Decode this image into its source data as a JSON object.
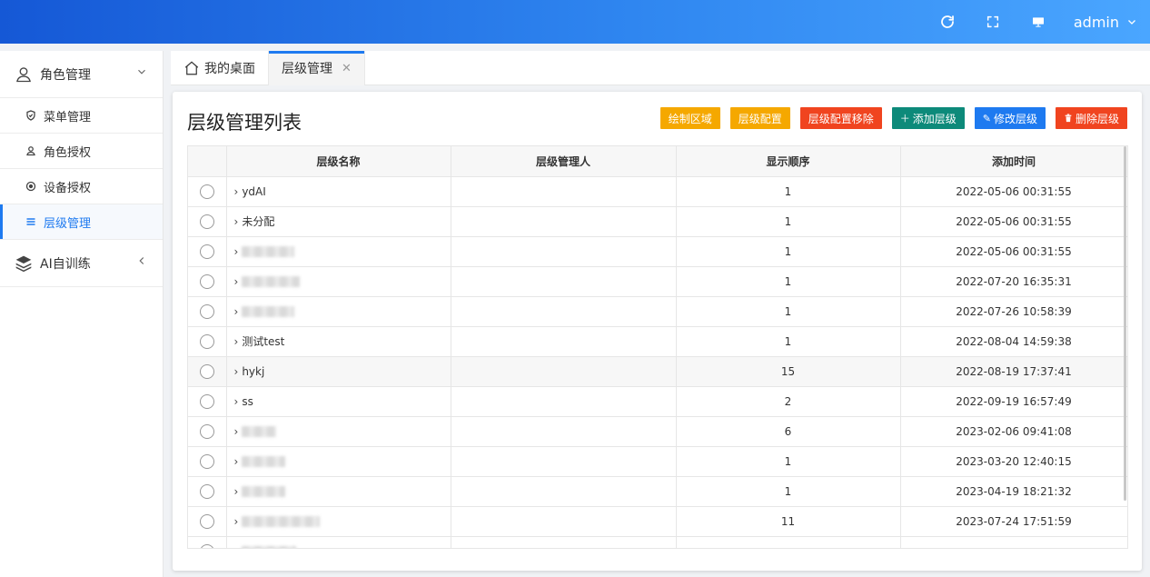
{
  "header": {
    "user": "admin",
    "tools": [
      "refresh-icon",
      "fullscreen-icon",
      "monitor-icon"
    ]
  },
  "sidebar": {
    "groups": [
      {
        "label": "角色管理",
        "icon": "user-icon",
        "expanded": true,
        "items": [
          {
            "label": "菜单管理",
            "icon": "shield-icon"
          },
          {
            "label": "角色授权",
            "icon": "user-small-icon"
          },
          {
            "label": "设备授权",
            "icon": "target-icon"
          },
          {
            "label": "层级管理",
            "icon": "list-icon",
            "active": true
          }
        ]
      },
      {
        "label": "AI自训练",
        "icon": "layers-icon",
        "expanded": false
      }
    ]
  },
  "tabs": [
    {
      "label": "我的桌面",
      "icon": "home-icon"
    },
    {
      "label": "层级管理",
      "active": true,
      "closable": true
    }
  ],
  "panel": {
    "title": "层级管理列表",
    "buttons": [
      {
        "label": "绘制区域",
        "color": "#f5a800"
      },
      {
        "label": "层级配置",
        "color": "#f5a800"
      },
      {
        "label": "层级配置移除",
        "color": "#f0441f"
      },
      {
        "label": "添加层级",
        "color": "#0d8a7a",
        "icon": "+"
      },
      {
        "label": "修改层级",
        "color": "#1e7af0",
        "icon": "✎"
      },
      {
        "label": "删除层级",
        "color": "#f0441f",
        "icon": "🗑"
      }
    ]
  },
  "table": {
    "columns": [
      "",
      "层级名称",
      "层级管理人",
      "显示顺序",
      "添加时间"
    ],
    "rows": [
      {
        "name": "ydAI",
        "manager": "",
        "order": "1",
        "time": "2022-05-06 00:31:55"
      },
      {
        "name": "未分配",
        "manager": "",
        "order": "1",
        "time": "2022-05-06 00:31:55"
      },
      {
        "name": "",
        "manager": "",
        "order": "1",
        "time": "2022-05-06 00:31:55",
        "blur": 58
      },
      {
        "name": "",
        "manager": "",
        "order": "1",
        "time": "2022-07-20 16:35:31",
        "blur": 64
      },
      {
        "name": "",
        "manager": "",
        "order": "1",
        "time": "2022-07-26 10:58:39",
        "blur": 58
      },
      {
        "name": "测试test",
        "manager": "",
        "order": "1",
        "time": "2022-08-04 14:59:38"
      },
      {
        "name": "hykj",
        "manager": "",
        "order": "15",
        "time": "2022-08-19 17:37:41",
        "highlight": true
      },
      {
        "name": "ss",
        "manager": "",
        "order": "2",
        "time": "2022-09-19 16:57:49"
      },
      {
        "name": "",
        "manager": "",
        "order": "6",
        "time": "2023-02-06 09:41:08",
        "blur": 38
      },
      {
        "name": "",
        "manager": "",
        "order": "1",
        "time": "2023-03-20 12:40:15",
        "blur": 48
      },
      {
        "name": "",
        "manager": "",
        "order": "1",
        "time": "2023-04-19 18:21:32",
        "blur": 48
      },
      {
        "name": "",
        "manager": "",
        "order": "11",
        "time": "2023-07-24 17:51:59",
        "blur": 86
      },
      {
        "name": "",
        "manager": "",
        "order": "",
        "time": "",
        "blur": 60
      }
    ]
  }
}
